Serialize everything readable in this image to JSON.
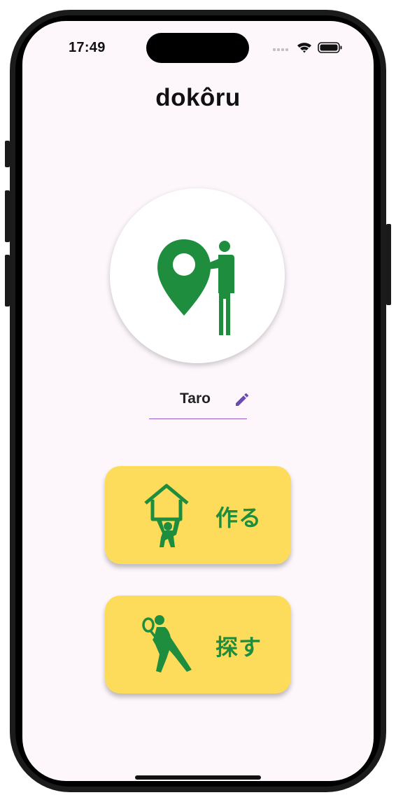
{
  "status_bar": {
    "time": "17:49"
  },
  "header": {
    "title": "dokôru"
  },
  "logo": {
    "icon": "map-pin-person-icon"
  },
  "profile": {
    "name": "Taro",
    "edit_icon": "pencil-icon"
  },
  "actions": [
    {
      "label": "作る",
      "icon": "person-lifting-house-icon"
    },
    {
      "label": "探す",
      "icon": "person-searching-magnifier-icon"
    }
  ],
  "colors": {
    "accent_green": "#1e8e3e",
    "button_yellow": "#fedc5b",
    "edit_purple": "#6a4bb3",
    "underline_purple": "#9b59c9",
    "screen_bg": "#fdf7fc"
  }
}
